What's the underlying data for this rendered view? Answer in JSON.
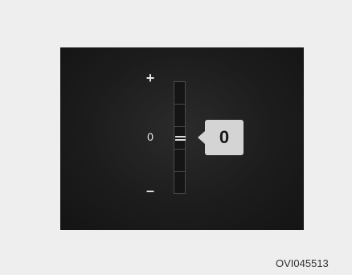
{
  "display": {
    "scale": {
      "plus_label": "+",
      "zero_label": "0",
      "minus_label": "–"
    },
    "current_value_label": "0",
    "level": 0
  },
  "figure_code": "OVI045513"
}
